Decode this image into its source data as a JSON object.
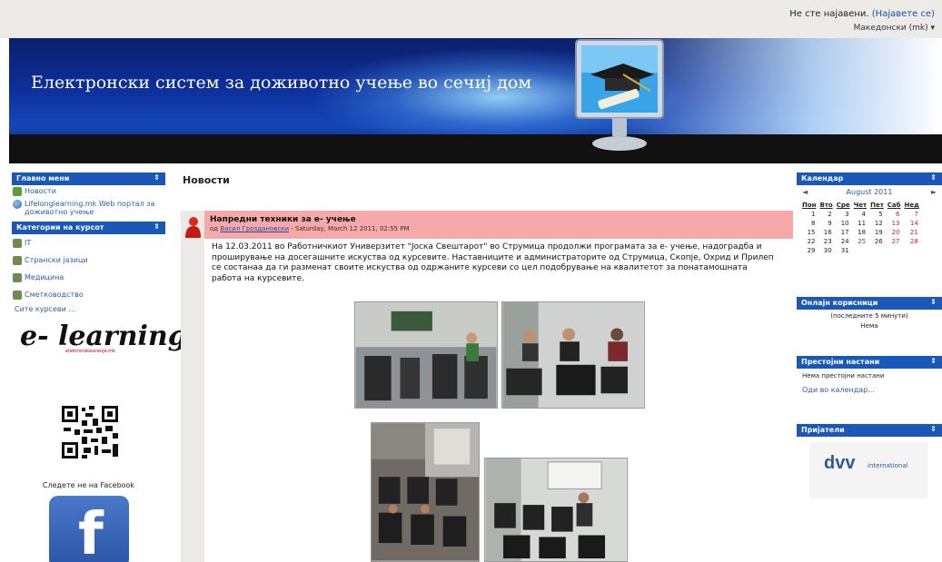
{
  "header": {
    "login_text": "Не сте најавени.",
    "login_link": "(Најавете се)",
    "language": "Македонски (mk)",
    "banner_title": "Електронски систем за доживотно учење во сечиј дом"
  },
  "left": {
    "main_menu_title": "Главно мени",
    "main_menu_items": [
      {
        "label": "Новости",
        "icon": "news-icon"
      },
      {
        "label": "Lifelonglearning.mk Web портал за доживотно учење",
        "icon": "globe-icon"
      }
    ],
    "categories_title": "Категории на курсот",
    "categories": [
      "IT",
      "Странски јазици",
      "Медицина",
      "Сметководство"
    ],
    "all_courses": "Сите курсеви ...",
    "logo_text": "e- learning",
    "logo_subtext": "elektronskoucenje.mk",
    "follow_text": "Следете не на Facebook",
    "fb_letter": "f"
  },
  "main": {
    "page_title": "Новости",
    "post": {
      "subject": "Напредни техники за е- учење",
      "author_prefix": "од",
      "author": "Васил Гроздановски",
      "date": "- Saturday, March 12 2011, 02:55 PM",
      "body": "На 12.03.2011 во Работничкиот Универзитет \"Јоска Свештарот\" во Струмица продолжи програмата за е- учење, надоградба и проширување на досегашните искуства од курсевите. Наставниците и администраторите од Струмица, Скопје, Охрид и Прилеп се состанаа да ги разменат своите искуства од одржаните курсеви со цел подобрување на квалитетот за понатамошната работа на курсевите."
    }
  },
  "right": {
    "calendar_title": "Календар",
    "calendar_month": "August 2011",
    "weekdays": [
      "Пон",
      "Вто",
      "Сре",
      "Чет",
      "Пет",
      "Саб",
      "Нед"
    ],
    "weeks": [
      [
        "1",
        "2",
        "3",
        "4",
        "5",
        "6",
        "7"
      ],
      [
        "8",
        "9",
        "10",
        "11",
        "12",
        "13",
        "14"
      ],
      [
        "15",
        "16",
        "17",
        "18",
        "19",
        "20",
        "21"
      ],
      [
        "22",
        "23",
        "24",
        "25",
        "26",
        "27",
        "28"
      ],
      [
        "29",
        "30",
        "31",
        "",
        "",
        "",
        ""
      ]
    ],
    "online_title": "Онлајн корисници",
    "online_sub": "(последните 5 минути)",
    "online_none": "Нема",
    "upcoming_title": "Престојни настани",
    "upcoming_none": "Нема престојни настани",
    "upcoming_link": "Оди во календар...",
    "friends_title": "Пријатели",
    "dvv_big": "dvv",
    "dvv_small": "international"
  },
  "colors": {
    "block_header": "#1957b8",
    "post_header": "#f7a8a8",
    "link": "#2a5db0"
  }
}
